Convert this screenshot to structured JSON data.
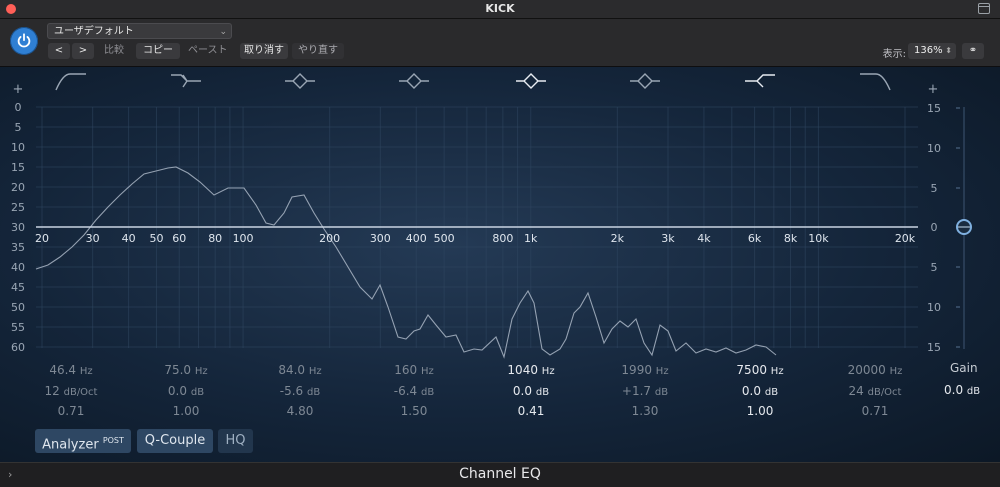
{
  "window": {
    "title": "KICK"
  },
  "toolbar": {
    "preset": "ユーザデフォルト",
    "prev": "<",
    "next": ">",
    "compare": "比較",
    "copy": "コピー",
    "paste": "ペースト",
    "undo": "取り消す",
    "redo": "やり直す",
    "zoom_label": "表示:",
    "zoom_value": "136%"
  },
  "graph": {
    "left_scale": [
      "0",
      "5",
      "10",
      "15",
      "20",
      "25",
      "30",
      "35",
      "40",
      "45",
      "50",
      "55",
      "60"
    ],
    "right_scale": [
      "15",
      "10",
      "5",
      "0",
      "5",
      "10",
      "15"
    ],
    "freq_labels": [
      "20",
      "30",
      "40",
      "50",
      "60",
      "80",
      "100",
      "200",
      "300",
      "400",
      "500",
      "800",
      "1k",
      "2k",
      "3k",
      "4k",
      "6k",
      "8k",
      "10k",
      "20k"
    ],
    "plus": "+"
  },
  "bands": [
    {
      "icon": "low-cut-icon",
      "freq": "46.4",
      "freq_unit": "Hz",
      "gain": "12",
      "gain_unit": "dB/Oct",
      "q": "0.71",
      "active": false
    },
    {
      "icon": "low-shelf-icon",
      "freq": "75.0",
      "freq_unit": "Hz",
      "gain": "0.0",
      "gain_unit": "dB",
      "q": "1.00",
      "active": false
    },
    {
      "icon": "bell-icon",
      "freq": "84.0",
      "freq_unit": "Hz",
      "gain": "-5.6",
      "gain_unit": "dB",
      "q": "4.80",
      "active": false
    },
    {
      "icon": "bell-icon",
      "freq": "160",
      "freq_unit": "Hz",
      "gain": "-6.4",
      "gain_unit": "dB",
      "q": "1.50",
      "active": false
    },
    {
      "icon": "bell-icon",
      "freq": "1040",
      "freq_unit": "Hz",
      "gain": "0.0",
      "gain_unit": "dB",
      "q": "0.41",
      "active": true
    },
    {
      "icon": "bell-icon",
      "freq": "1990",
      "freq_unit": "Hz",
      "gain": "+1.7",
      "gain_unit": "dB",
      "q": "1.30",
      "active": false
    },
    {
      "icon": "high-shelf-icon",
      "freq": "7500",
      "freq_unit": "Hz",
      "gain": "0.0",
      "gain_unit": "dB",
      "q": "1.00",
      "active": true
    },
    {
      "icon": "high-cut-icon",
      "freq": "20000",
      "freq_unit": "Hz",
      "gain": "24",
      "gain_unit": "dB/Oct",
      "q": "0.71",
      "active": false
    }
  ],
  "gain": {
    "title": "Gain",
    "value": "0.0",
    "unit": "dB"
  },
  "buttons": {
    "analyzer": "Analyzer",
    "analyzer_post": "POST",
    "qcouple": "Q-Couple",
    "hq": "HQ"
  },
  "footer": {
    "plugin_name": "Channel EQ"
  },
  "colors": {
    "accent": "#2f7fd3",
    "curve": "#c9d4e2",
    "grid": "#2f4660"
  }
}
